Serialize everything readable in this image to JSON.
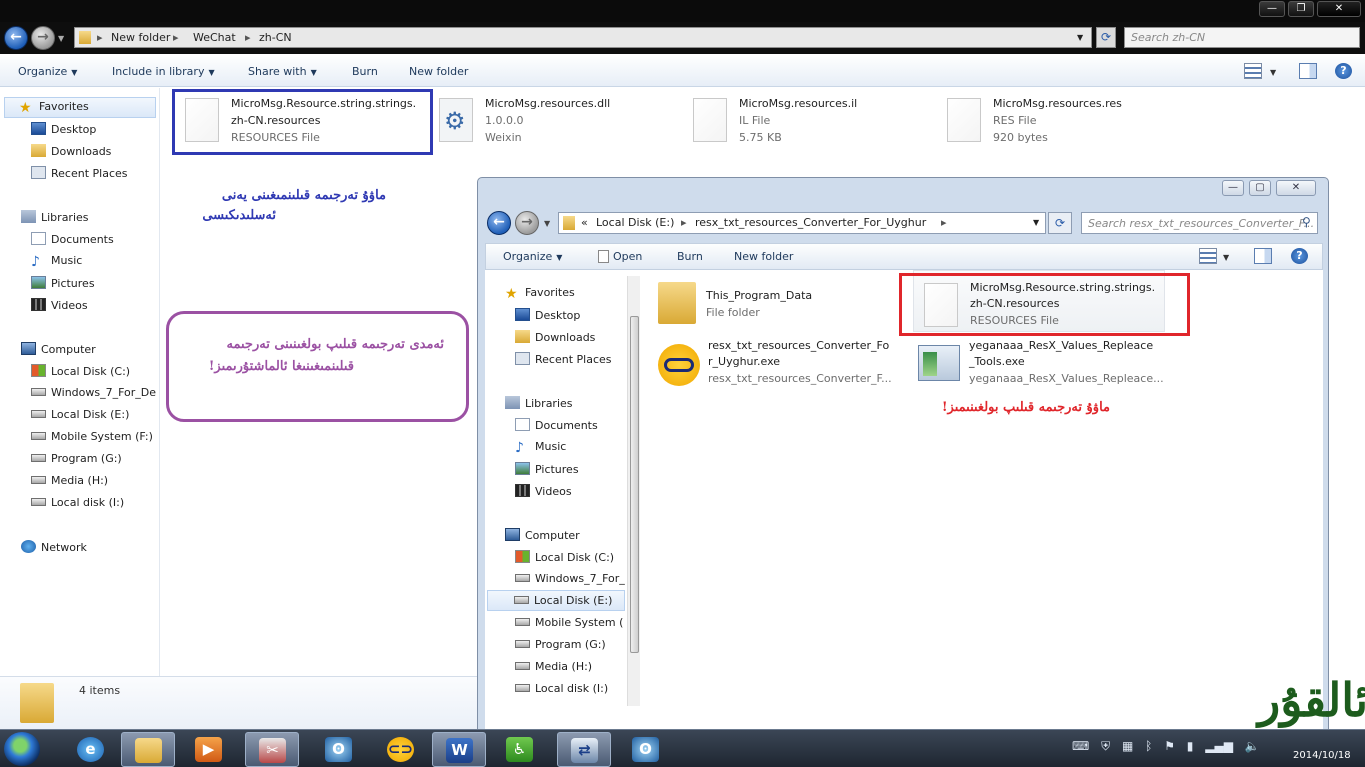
{
  "main_window": {
    "breadcrumb": [
      "New folder",
      "WeChat",
      "zh-CN"
    ],
    "search_placeholder": "Search zh-CN",
    "toolbar": {
      "organize": "Organize",
      "include_in_library": "Include in library",
      "share_with": "Share with",
      "burn": "Burn",
      "new_folder": "New folder"
    },
    "nav": {
      "favorites": "Favorites",
      "desktop": "Desktop",
      "downloads": "Downloads",
      "recent_places": "Recent Places",
      "libraries": "Libraries",
      "documents": "Documents",
      "music": "Music",
      "pictures": "Pictures",
      "videos": "Videos",
      "computer": "Computer",
      "drive_c": "Local Disk (C:)",
      "drive_d": "Windows_7_For_De",
      "drive_e": "Local Disk (E:)",
      "drive_f": "Mobile System (F:)",
      "drive_g": "Program (G:)",
      "drive_h": "Media (H:)",
      "drive_i": "Local disk (I:)",
      "network": "Network"
    },
    "files": [
      {
        "name_line1": "MicroMsg.Resource.string.strings.",
        "name_line2": "zh-CN.resources",
        "type": "RESOURCES File"
      },
      {
        "name_line1": "MicroMsg.resources.dll",
        "version": "1.0.0.0",
        "company": "Weixin"
      },
      {
        "name_line1": "MicroMsg.resources.il",
        "type": "IL File",
        "size": "5.75 KB"
      },
      {
        "name_line1": "MicroMsg.resources.res",
        "type": "RES File",
        "size": "920 bytes"
      }
    ],
    "status_items": "4 items"
  },
  "annotations": {
    "blue_line1": "ماۋۇ تەرجىمە قىلىنمىغىنى يەنى",
    "blue_line2": "ئەسلىدىكىسى",
    "purple_line1": "ئەمدى تەرجىمە قىلىپ بولغىنىنى تەرجىمە",
    "purple_line2": "قىلىنمىغىنىغا ئالماشتۇرىمىز!",
    "red": "ماۋۇ تەرجىمە قىلىپ بولغىنىمىز!"
  },
  "second_window": {
    "breadcrumb_prefix": "«",
    "breadcrumb": [
      "Local Disk (E:)",
      "resx_txt_resources_Converter_For_Uyghur"
    ],
    "search_placeholder": "Search resx_txt_resources_Converter_F...",
    "toolbar": {
      "organize": "Organize",
      "open": "Open",
      "burn": "Burn",
      "new_folder": "New folder"
    },
    "nav": {
      "favorites": "Favorites",
      "desktop": "Desktop",
      "downloads": "Downloads",
      "recent_places": "Recent Places",
      "libraries": "Libraries",
      "documents": "Documents",
      "music": "Music",
      "pictures": "Pictures",
      "videos": "Videos",
      "computer": "Computer",
      "drive_c": "Local Disk (C:)",
      "drive_d": "Windows_7_For_",
      "drive_e": "Local Disk (E:)",
      "drive_f": "Mobile System (",
      "drive_g": "Program (G:)",
      "drive_h": "Media (H:)",
      "drive_i": "Local disk (I:)"
    },
    "files": [
      {
        "name_line1": "This_Program_Data",
        "type": "File folder"
      },
      {
        "name_line1": "MicroMsg.Resource.string.strings.",
        "name_line2": "zh-CN.resources",
        "type": "RESOURCES File"
      },
      {
        "name_line1": "resx_txt_resources_Converter_Fo",
        "name_line2": "r_Uyghur.exe",
        "desc": "resx_txt_resources_Converter_F..."
      },
      {
        "name_line1": "yeganaaa_ResX_Values_Replеace",
        "name_line2": "_Tools.exe",
        "desc": "yeganaaa_ResX_Values_Replеace..."
      }
    ]
  },
  "taskbar": {
    "apps": [
      "start-button",
      "ie",
      "explorer",
      "media-player",
      "paint-tool",
      "owl-app",
      "converter-app",
      "word",
      "accessibility",
      "resx-tool",
      "owl-app-2"
    ]
  },
  "colors": {
    "blue_annotation": "#2f39b3",
    "purple_annotation": "#9b51a3",
    "red_annotation": "#e0262b"
  }
}
